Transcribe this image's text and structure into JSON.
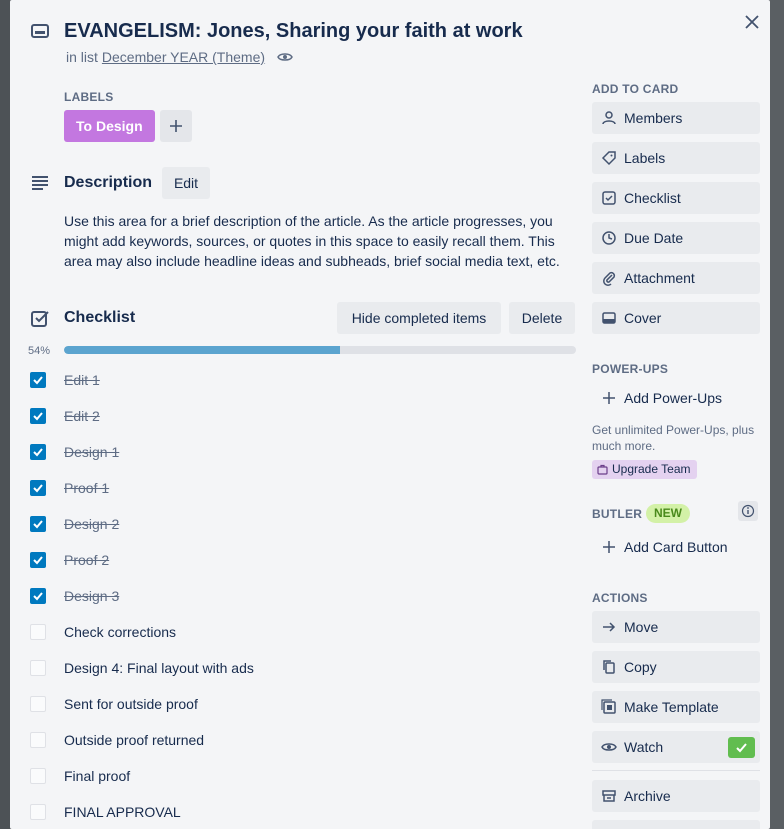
{
  "window": {
    "close_label": "Close"
  },
  "card": {
    "title": "EVANGELISM: Jones, Sharing your faith at work",
    "in_list_prefix": "in list",
    "list_name": "December YEAR (Theme)"
  },
  "labels": {
    "heading": "LABELS",
    "items": [
      {
        "text": "To Design",
        "color": "#c377e0"
      }
    ],
    "add_symbol": "+"
  },
  "description": {
    "heading": "Description",
    "edit_label": "Edit",
    "text": "Use this area for a brief description of the article. As the article progresses, you might add keywords, sources, or quotes in this space to easily recall them. This area may also include headline ideas and subheads, brief social media text, etc."
  },
  "checklist": {
    "heading": "Checklist",
    "hide_label": "Hide completed items",
    "delete_label": "Delete",
    "percent_text": "54%",
    "progress": 0.54,
    "items": [
      {
        "text": "Edit 1",
        "done": true
      },
      {
        "text": "Edit 2",
        "done": true
      },
      {
        "text": "Design 1",
        "done": true
      },
      {
        "text": "Proof 1",
        "done": true
      },
      {
        "text": "Design 2",
        "done": true
      },
      {
        "text": "Proof 2",
        "done": true
      },
      {
        "text": "Design 3",
        "done": true
      },
      {
        "text": "Check corrections",
        "done": false
      },
      {
        "text": "Design 4: Final layout with ads",
        "done": false
      },
      {
        "text": "Sent for outside proof",
        "done": false
      },
      {
        "text": "Outside proof returned",
        "done": false
      },
      {
        "text": "Final proof",
        "done": false
      },
      {
        "text": "FINAL APPROVAL",
        "done": false
      }
    ]
  },
  "sidebar": {
    "add_to_card": {
      "heading": "ADD TO CARD",
      "buttons": [
        {
          "label": "Members",
          "icon": "person-icon"
        },
        {
          "label": "Labels",
          "icon": "tag-icon"
        },
        {
          "label": "Checklist",
          "icon": "checklist-icon"
        },
        {
          "label": "Due Date",
          "icon": "clock-icon"
        },
        {
          "label": "Attachment",
          "icon": "paperclip-icon"
        },
        {
          "label": "Cover",
          "icon": "cover-icon"
        }
      ]
    },
    "power_ups": {
      "heading": "POWER-UPS",
      "add_label": "Add Power-Ups",
      "note": "Get unlimited Power-Ups, plus much more.",
      "upgrade_label": "Upgrade Team"
    },
    "butler": {
      "heading": "BUTLER",
      "badge": "NEW",
      "add_label": "Add Card Button"
    },
    "actions": {
      "heading": "ACTIONS",
      "buttons": [
        {
          "label": "Move",
          "icon": "arrow-right-icon"
        },
        {
          "label": "Copy",
          "icon": "copy-icon"
        },
        {
          "label": "Make Template",
          "icon": "template-icon"
        },
        {
          "label": "Watch",
          "icon": "eye-icon"
        },
        {
          "label": "Archive",
          "icon": "archive-icon"
        }
      ]
    }
  },
  "colors": {
    "accent_blue": "#0079bf",
    "progress": "#5ba4cf",
    "label_purple": "#c377e0",
    "watch_green": "#61bd4f"
  }
}
